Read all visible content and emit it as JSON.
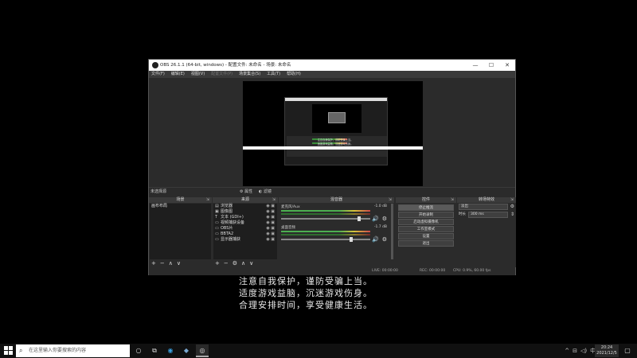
{
  "obs": {
    "title": "OBS 26.1.1 (64-bit, windows) - 配置文件: 未命名 - 场景: 未命名",
    "window_buttons": [
      "—",
      "☐",
      "✕"
    ],
    "menu": [
      "文件(F)",
      "编辑(E)",
      "视图(V)",
      "配置文件(P)",
      "场景集合(S)",
      "工具(T)",
      "帮助(H)"
    ],
    "nested_text": "注意自我保护，谨防受骗上当。\n适度游戏益脑，沉迷游戏伤身。\n合理安排时间，享受健康生活。",
    "scene_bar": {
      "selection": "未选择源",
      "properties": "属性",
      "filters": "滤镜"
    },
    "docks": {
      "scenes": {
        "title": "场景",
        "items": [
          "画布布局"
        ]
      },
      "sources": {
        "title": "来源",
        "items": [
          {
            "icon": "▤",
            "name": "浏览器"
          },
          {
            "icon": "▣",
            "name": "图像图"
          },
          {
            "icon": "T",
            "name": "文本 (GDI+)"
          },
          {
            "icon": "▭",
            "name": "视频捕获设备"
          },
          {
            "icon": "▭",
            "name": "OBS片"
          },
          {
            "icon": "▭",
            "name": "BBTA2"
          },
          {
            "icon": "▭",
            "name": "显示器捕获"
          }
        ]
      },
      "mixer": {
        "title": "混音器",
        "tracks": [
          {
            "name": "麦克风/Aux",
            "db": "-1.0 dB"
          },
          {
            "name": "桌面音频",
            "db": "-1.7 dB"
          }
        ]
      },
      "controls": {
        "title": "控件",
        "buttons": [
          "停止推流",
          "开始录制",
          "启动虚拟摄像机",
          "工作室模式",
          "设置",
          "退出"
        ]
      },
      "transitions": {
        "title": "转场特效",
        "type": "淡出",
        "duration_label": "时长",
        "duration_value": "300 ms"
      }
    },
    "status": {
      "live": "LIVE: 00:00:00",
      "rec": "REC: 00:00:00",
      "cpu": "CPU: 0.9%, 60.00 fps"
    }
  },
  "advisory": [
    "注意自我保护，谨防受骗上当。",
    "适度游戏益脑，沉迷游戏伤身。",
    "合理安排时间，享受健康生活。"
  ],
  "taskbar": {
    "search_placeholder": "在这里输入你要搜索的内容",
    "time": "20:24",
    "date": "2021/12/5"
  }
}
